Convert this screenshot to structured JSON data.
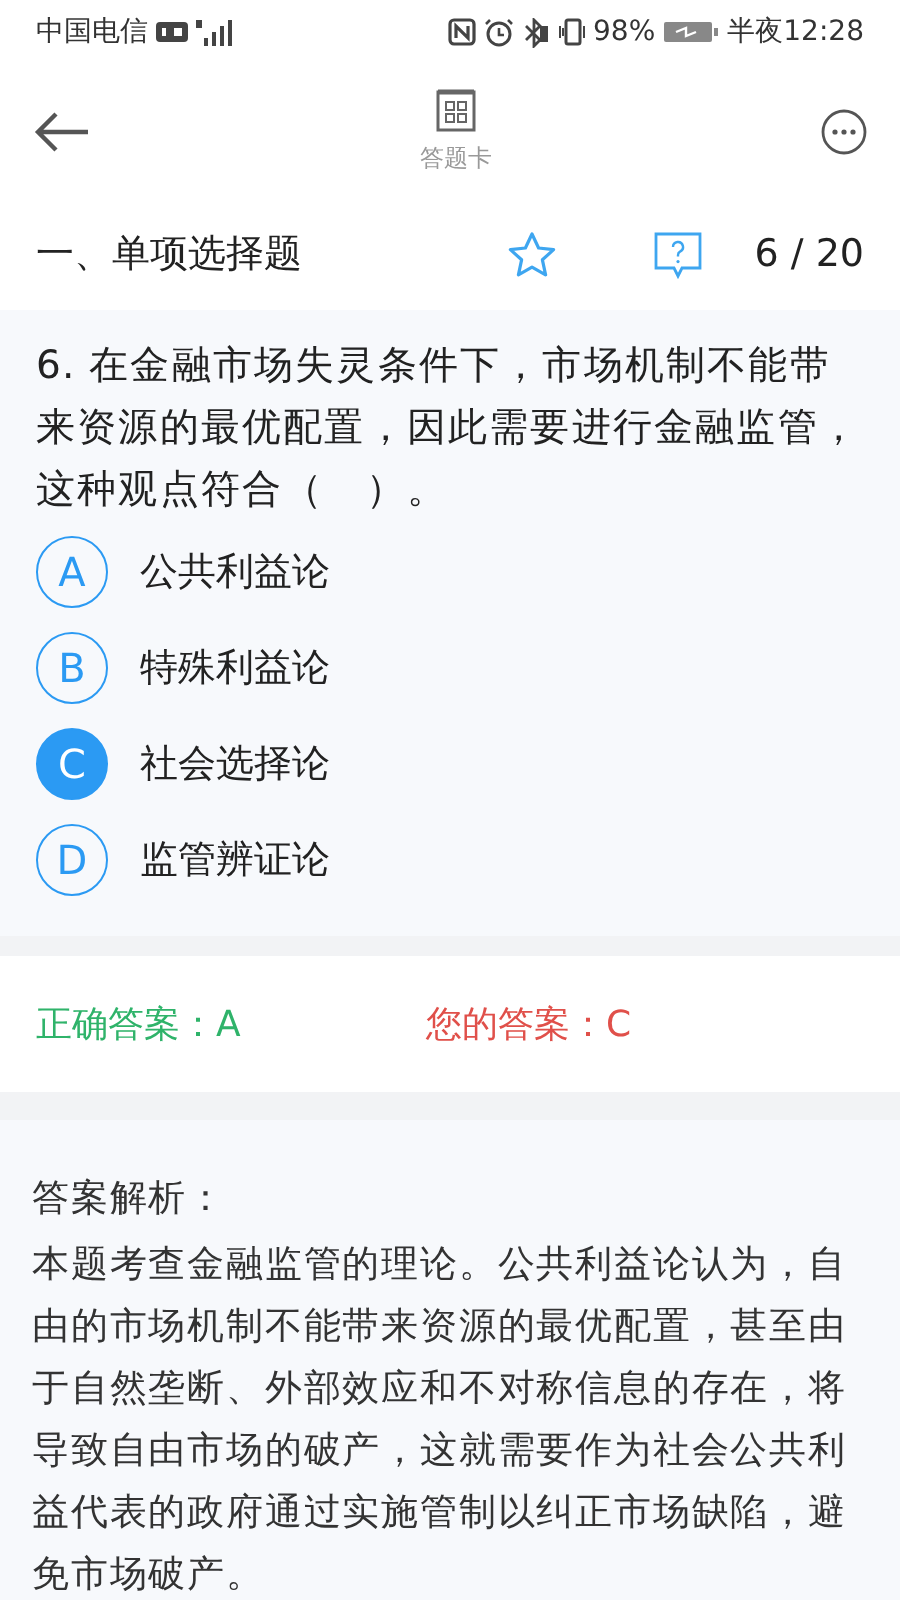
{
  "status_bar": {
    "carrier": "中国电信",
    "battery": "98%",
    "time": "半夜12:28"
  },
  "header": {
    "card_label": "答题卡"
  },
  "section": {
    "title": "一、单项选择题",
    "progress": "6 / 20"
  },
  "question": {
    "text": "6. 在金融市场失灵条件下，市场机制不能带来资源的最优配置，因此需要进行金融监管，这种观点符合（　）。",
    "options": [
      {
        "letter": "A",
        "text": "公共利益论",
        "selected": false
      },
      {
        "letter": "B",
        "text": "特殊利益论",
        "selected": false
      },
      {
        "letter": "C",
        "text": "社会选择论",
        "selected": true
      },
      {
        "letter": "D",
        "text": "监管辨证论",
        "selected": false
      }
    ]
  },
  "answers": {
    "correct_label": "正确答案：",
    "correct": "A",
    "yours_label": "您的答案：",
    "yours": "C"
  },
  "explanation": {
    "title": "答案解析：",
    "text": "本题考查金融监管的理论。公共利益论认为，自由的市场机制不能带来资源的最优配置，甚至由于自然垄断、外部效应和不对称信息的存在，将导致自由市场的破产，这就需要作为社会公共利益代表的政府通过实施管制以纠正市场缺陷，避免市场破产。"
  }
}
